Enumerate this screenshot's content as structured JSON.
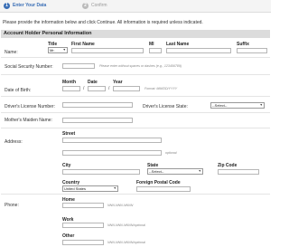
{
  "steps": [
    {
      "number": "1",
      "label": "Enter Your Data"
    },
    {
      "number": "2",
      "label": "Confirm"
    }
  ],
  "intro_text": "Please provide the information below and click Continue. All information is required unless indicated.",
  "section_title": "Account Holder Personal Information",
  "name": {
    "label": "Name:",
    "title_header": "Title",
    "title_value": "Mr.",
    "first_header": "First Name",
    "mi_header": "MI",
    "last_header": "Last Name",
    "suffix_header": "Suffix"
  },
  "ssn": {
    "label": "Social Security Number:",
    "hint": "Please enter without spaces or dashes (e.g., 123456789)"
  },
  "dob": {
    "label": "Date of Birth:",
    "month_header": "Month",
    "date_header": "Date",
    "year_header": "Year",
    "sep": "/",
    "format_hint": "Format: MM/DD/YYYY"
  },
  "drivers_license": {
    "number_label": "Driver's License Number:",
    "state_label": "Driver's License State:",
    "state_value": "--Select--"
  },
  "mothers_maiden": {
    "label": "Mother's Maiden Name:"
  },
  "address": {
    "label": "Address:",
    "street_header": "Street",
    "optional_hint": "optional",
    "city_header": "City",
    "state_header": "State",
    "state_value": "--Select--",
    "zip_header": "Zip Code",
    "country_header": "Country",
    "country_value": "United States",
    "foreign_postal_header": "Foreign Postal Code"
  },
  "phone": {
    "label": "Phone:",
    "home_header": "Home",
    "home_hint": "NNN-NNN-NNNN",
    "work_header": "Work",
    "work_hint": "NNN-NNN-NNNN/optional",
    "other_header": "Other",
    "other_hint": "NNN-NNN-NNNN/optional"
  }
}
